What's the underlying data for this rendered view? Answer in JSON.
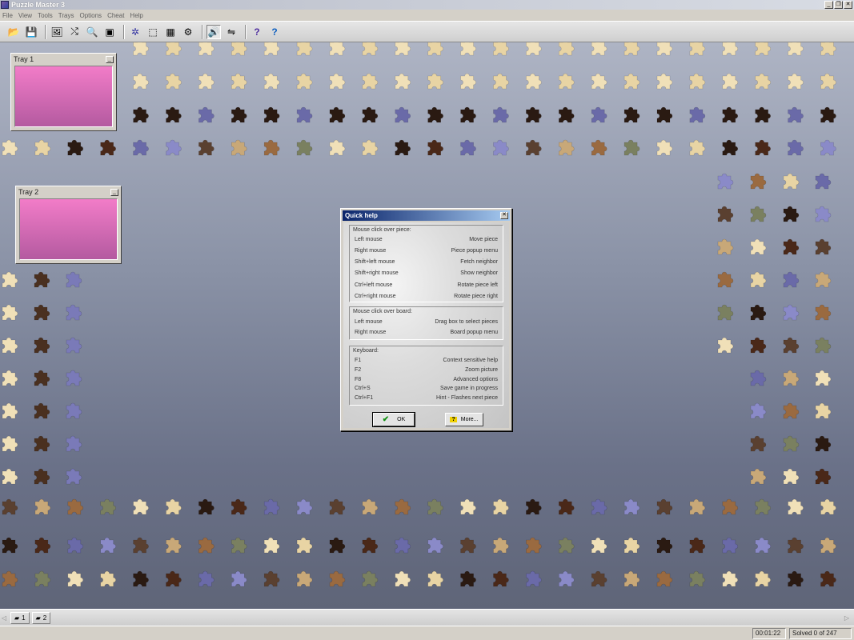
{
  "window": {
    "title": "Puzzle Master 3",
    "buttons": [
      "_",
      "❐",
      "✕"
    ]
  },
  "menu": [
    "File",
    "View",
    "Tools",
    "Trays",
    "Options",
    "Cheat",
    "Help"
  ],
  "toolbar": {
    "buttons": [
      {
        "name": "open-icon",
        "glyph": "📂"
      },
      {
        "name": "save-icon",
        "glyph": "💾"
      },
      {
        "name": "picture-icon",
        "glyph": "🖼"
      },
      {
        "name": "shuffle-icon",
        "glyph": "⤭"
      },
      {
        "name": "zoom-icon",
        "glyph": "🔍"
      },
      {
        "name": "preview-icon",
        "glyph": "▣"
      },
      {
        "name": "edge-pieces-icon",
        "glyph": "✲"
      },
      {
        "name": "select-box-icon",
        "glyph": "⬚"
      },
      {
        "name": "grid-icon",
        "glyph": "▦"
      },
      {
        "name": "gear-icon",
        "glyph": "⚙"
      },
      {
        "name": "sound-icon",
        "glyph": "🔊"
      },
      {
        "name": "hint-icon",
        "glyph": "⇋"
      },
      {
        "name": "help-piece-icon",
        "glyph": "?"
      },
      {
        "name": "question-icon",
        "glyph": "?"
      }
    ]
  },
  "trays": [
    {
      "title": "Tray 1",
      "min": "_"
    },
    {
      "title": "Tray 2",
      "min": "_"
    }
  ],
  "dialog": {
    "title": "Quick help",
    "close": "✕",
    "group1_title": "Mouse click over piece:",
    "group1": [
      [
        "Left mouse",
        "Move piece"
      ],
      [
        "Right mouse",
        "Piece popup menu"
      ],
      [
        "Shift+left mouse",
        "Fetch neighbor"
      ],
      [
        "Shift+right mouse",
        "Show neighbor"
      ],
      [
        "Ctrl+left mouse",
        "Rotate piece left"
      ],
      [
        "Ctrl+right mouse",
        "Rotate piece right"
      ]
    ],
    "group2_title": "Mouse click over board:",
    "group2": [
      [
        "Left mouse",
        "Drag box to select pieces"
      ],
      [
        "Right mouse",
        "Board popup menu"
      ]
    ],
    "group3_title": "Keyboard:",
    "group3": [
      [
        "F1",
        "Context sensitive help"
      ],
      [
        "F2",
        "Zoom picture"
      ],
      [
        "F8",
        "Advanced options"
      ],
      [
        "Ctrl+S",
        "Save game in progress"
      ],
      [
        "Ctrl+F1",
        "Hint - Flashes next piece"
      ]
    ],
    "ok_label": "OK",
    "more_label": "More..."
  },
  "bottom_tabs": [
    {
      "label": "1"
    },
    {
      "label": "2"
    }
  ],
  "status": {
    "time": "00:01:22",
    "solved": "Solved 0 of 247"
  },
  "colors": {
    "tray_top": "#f27cc8",
    "tray_bottom": "#b45aa0",
    "dialog_title": "#0a246a"
  }
}
